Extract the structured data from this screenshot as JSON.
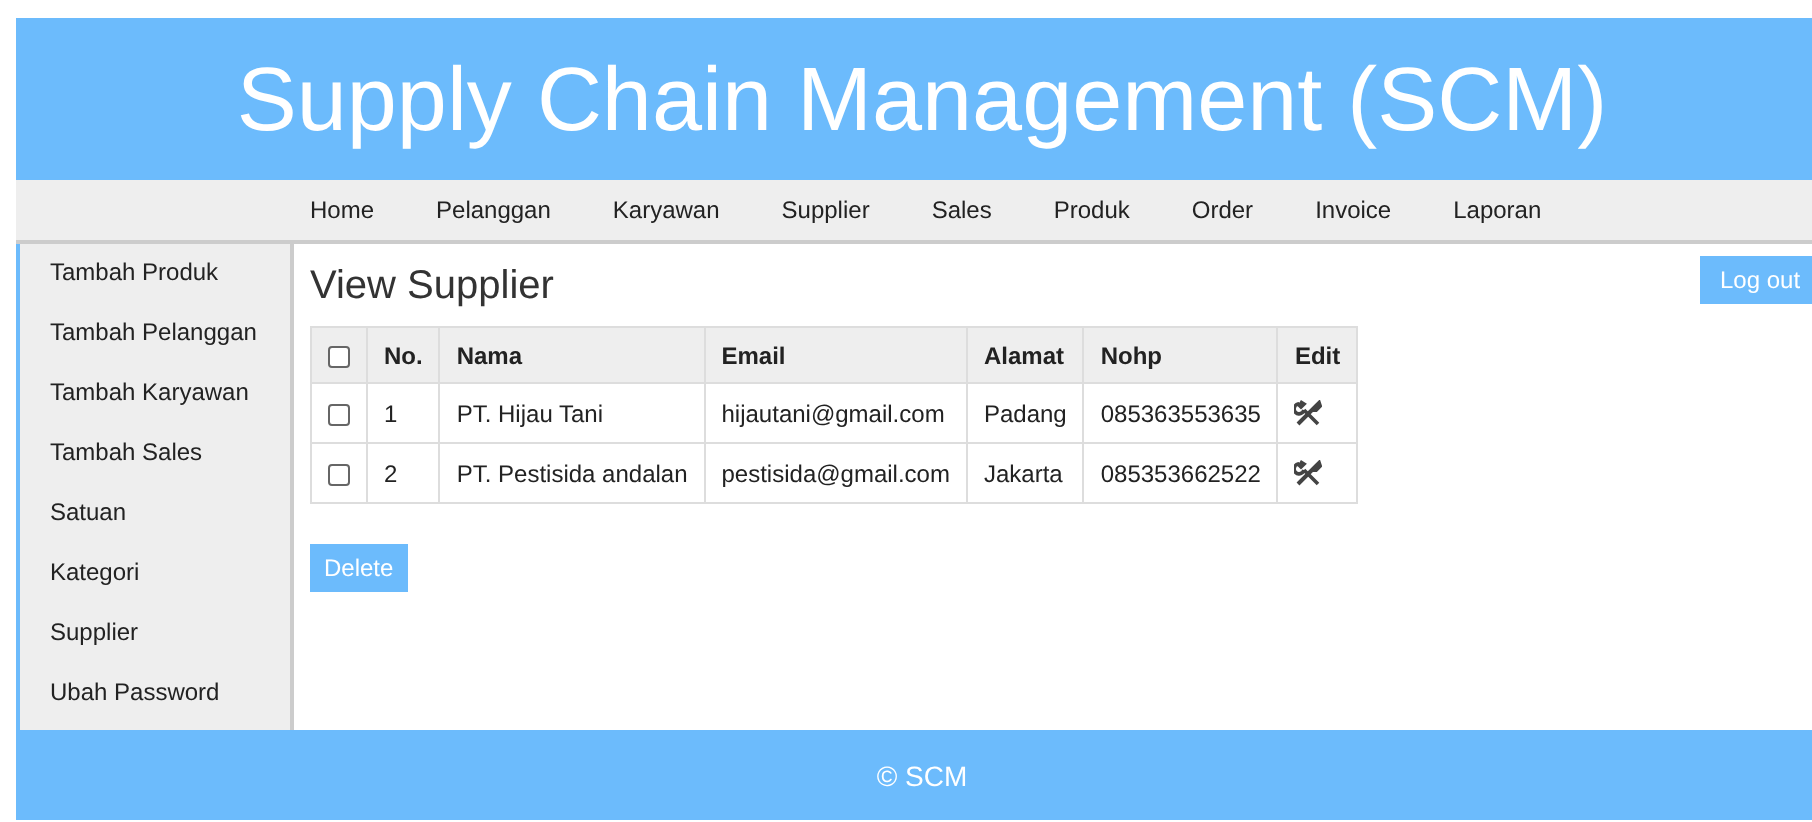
{
  "header": {
    "title": "Supply Chain Management (SCM)"
  },
  "nav": [
    "Home",
    "Pelanggan",
    "Karyawan",
    "Supplier",
    "Sales",
    "Produk",
    "Order",
    "Invoice",
    "Laporan"
  ],
  "sidebar": [
    "Tambah Produk",
    "Tambah Pelanggan",
    "Tambah Karyawan",
    "Tambah Sales",
    "Satuan",
    "Kategori",
    "Supplier",
    "Ubah Password"
  ],
  "page_title": "View Supplier",
  "logout": "Log out",
  "table": {
    "select_all": {
      "checked": false
    },
    "columns": [
      "No.",
      "Nama",
      "Email",
      "Alamat",
      "Nohp",
      "Edit"
    ],
    "rows": [
      {
        "checked": false,
        "no": "1",
        "nama": "PT. Hijau Tani",
        "email": "hijautani@gmail.com",
        "alamat": "Padang",
        "nohp": "085363553635"
      },
      {
        "checked": false,
        "no": "2",
        "nama": "PT. Pestisida andalan",
        "email": "pestisida@gmail.com",
        "alamat": "Jakarta",
        "nohp": "085353662522"
      }
    ]
  },
  "delete_button": "Delete",
  "footer": "© SCM"
}
